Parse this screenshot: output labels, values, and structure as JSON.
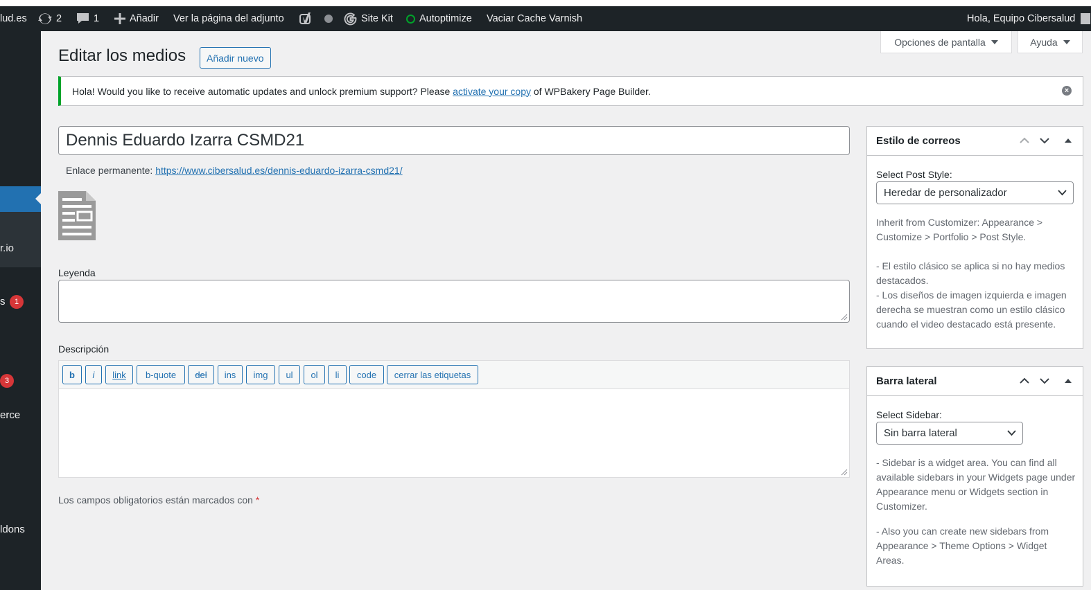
{
  "adminbar": {
    "site": "lud.es",
    "updates_count": "2",
    "comments_count": "1",
    "add_new": "Añadir",
    "view_attachment": "Ver la página del adjunto",
    "site_kit": "Site Kit",
    "autoptimize": "Autoptimize",
    "varnish": "Vaciar Cache Varnish",
    "greeting": "Hola, Equipo Cibersalud"
  },
  "sidebar": {
    "items": [
      {
        "label": "r.io"
      },
      {
        "label": "s",
        "badge": "1"
      },
      {
        "label": "",
        "badge": "3"
      },
      {
        "label": "erce"
      },
      {
        "label": "ldons"
      }
    ]
  },
  "screen_options": {
    "label": "Opciones de pantalla"
  },
  "help": {
    "label": "Ayuda"
  },
  "page": {
    "title": "Editar los medios",
    "add_new": "Añadir nuevo"
  },
  "notice": {
    "before": "Hola! Would you like to receive automatic updates and unlock premium support? Please ",
    "link": "activate your copy",
    "after": " of WPBakery Page Builder."
  },
  "post": {
    "title": "Dennis Eduardo Izarra CSMD21",
    "permalink_label": "Enlace permanente:",
    "permalink_url": "https://www.cibersalud.es/dennis-eduardo-izarra-csmd21/"
  },
  "fields": {
    "caption_label": "Leyenda",
    "caption_value": "",
    "description_label": "Descripción",
    "required_note": "Los campos obligatorios están marcados con",
    "required_star": "*"
  },
  "quicktags": [
    "b",
    "i",
    "link",
    "b-quote",
    "del",
    "ins",
    "img",
    "ul",
    "ol",
    "li",
    "code",
    "cerrar las etiquetas"
  ],
  "postbox_style": {
    "title": "Estilo de correos",
    "label": "Select Post Style:",
    "selected": "Heredar de personalizador",
    "desc1": "Inherit from Customizer: Appearance > Customize > Portfolio > Post Style.",
    "desc2": "- El estilo clásico se aplica si no hay medios destacados.",
    "desc3": "- Los diseños de imagen izquierda e imagen derecha se muestran como un estilo clásico cuando el video destacado está presente."
  },
  "postbox_sidebar": {
    "title": "Barra lateral",
    "label": "Select Sidebar:",
    "selected": "Sin barra lateral",
    "desc1": "- Sidebar is a widget area. You can find all available sidebars in your Widgets page under Appearance menu or Widgets section in Customizer.",
    "desc2": "- Also you can create new sidebars from Appearance > Theme Options > Widget Areas."
  },
  "colors": {
    "adminbar_bg": "#1d2327",
    "accent": "#2271b1",
    "notice_border": "#00a32a",
    "badge": "#d63638",
    "autoptimize_status": "#00a32a"
  }
}
